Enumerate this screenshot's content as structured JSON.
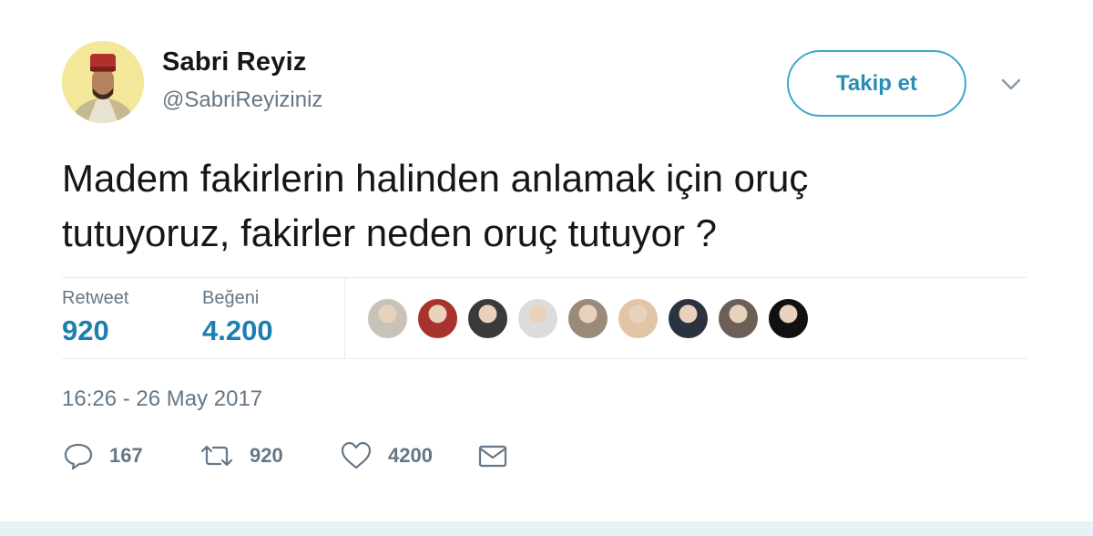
{
  "author": {
    "name": "Sabri Reyiz",
    "handle": "@SabriReyiziniz",
    "avatar_icon": "profile-avatar"
  },
  "follow_button": {
    "label": "Takip et"
  },
  "menu_icon": "chevron-down-icon",
  "tweet": {
    "text_line1": "Madem fakirlerin halinden anlamak için oruç",
    "text_line2": "tutuyoruz, fakirler neden oruç tutuyor ?"
  },
  "stats": {
    "retweet_label": "Retweet",
    "retweet_value": "920",
    "like_label": "Beğeni",
    "like_value": "4.200"
  },
  "likers": [
    {
      "color": "#c9c2b8"
    },
    {
      "color": "#a8322c"
    },
    {
      "color": "#3a3a3a"
    },
    {
      "color": "#dcdcdc"
    },
    {
      "color": "#9a8a7a"
    },
    {
      "color": "#e2c4a6"
    },
    {
      "color": "#2b3340"
    },
    {
      "color": "#6c5f58"
    },
    {
      "color": "#111111"
    }
  ],
  "timestamp": "16:26 - 26 May 2017",
  "actions": {
    "reply_count": "167",
    "retweet_count": "920",
    "like_count": "4200"
  },
  "colors": {
    "accent": "#1b7fb0",
    "secondary_text": "#657786",
    "border": "#e6ecf0"
  }
}
